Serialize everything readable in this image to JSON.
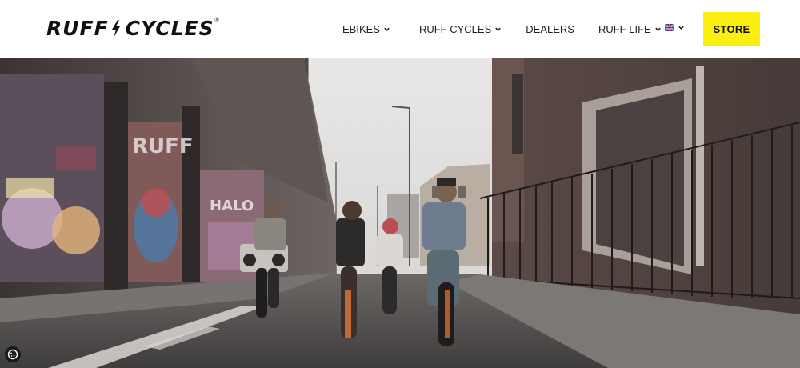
{
  "brand": {
    "name_left": "RUFF",
    "name_right": "CYCLES",
    "registered_mark": "®"
  },
  "nav": {
    "items": [
      {
        "label": "EBIKES",
        "has_dropdown": true
      },
      {
        "label": "RUFF CYCLES",
        "has_dropdown": true
      },
      {
        "label": "DEALERS",
        "has_dropdown": false
      },
      {
        "label": "RUFF LIFE",
        "has_dropdown": true
      }
    ],
    "language": {
      "icon": "uk-flag-icon",
      "has_dropdown": true
    },
    "store_label": "STORE"
  },
  "hero": {
    "wall_tag": "RUFF",
    "graffiti": "HALO"
  },
  "cookie": {
    "icon": "cookie-icon"
  },
  "colors": {
    "accent": "#fbef12",
    "text": "#222222",
    "header_bg": "#ffffff"
  }
}
